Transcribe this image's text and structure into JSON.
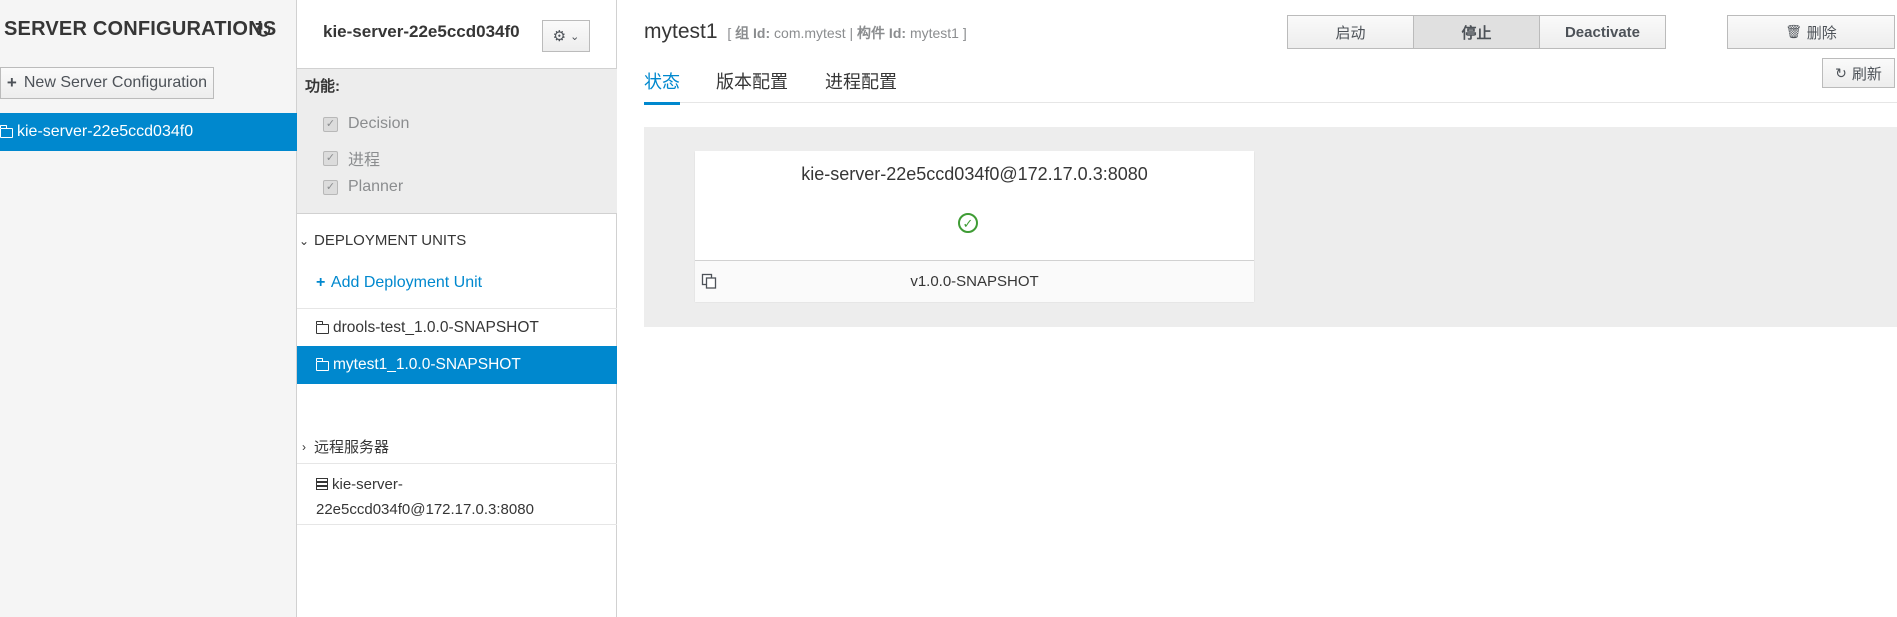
{
  "left": {
    "title": "SERVER CONFIGURATIONS",
    "new_config_label": "New Server Configuration",
    "items": [
      {
        "label": "kie-server-22e5ccd034f0"
      }
    ]
  },
  "middle": {
    "title": "kie-server-22e5ccd034f0",
    "features_label": "功能:",
    "features": [
      "Decision",
      "进程",
      "Planner"
    ],
    "deployment_units_label": "DEPLOYMENT UNITS",
    "add_unit_label": "Add Deployment Unit",
    "units": [
      {
        "label": "drools-test_1.0.0-SNAPSHOT",
        "selected": false
      },
      {
        "label": "mytest1_1.0.0-SNAPSHOT",
        "selected": true
      }
    ],
    "remote_servers_label": "远程服务器",
    "remote_servers": [
      {
        "line1": "kie-server-",
        "line2": "22e5ccd034f0@172.17.0.3:8080"
      }
    ]
  },
  "main": {
    "title": "mytest1",
    "meta_open": "[",
    "group_id_label": "组 Id:",
    "group_id": "com.mytest",
    "sep": "|",
    "artifact_id_label": "构件 Id:",
    "artifact_id": "mytest1",
    "meta_close": "]",
    "buttons": {
      "start": "启动",
      "stop": "停止",
      "deactivate": "Deactivate",
      "delete": "删除",
      "refresh": "刷新"
    },
    "tabs": [
      "状态",
      "版本配置",
      "进程配置"
    ],
    "active_tab": 0,
    "card": {
      "title": "kie-server-22e5ccd034f0@172.17.0.3:8080",
      "version": "v1.0.0-SNAPSHOT"
    }
  },
  "colors": {
    "accent": "#0088ce",
    "ok": "#3f9c35"
  }
}
